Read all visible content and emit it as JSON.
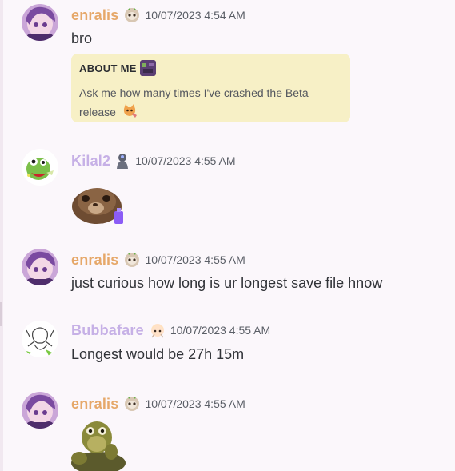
{
  "messages": [
    {
      "username": "enralis",
      "timestamp": "10/07/2023 4:54 AM",
      "text": "bro",
      "about_me": {
        "title": "ABOUT ME",
        "text": "Ask me how many times I've crashed the Beta",
        "text2": "release"
      }
    },
    {
      "username": "Kilal2",
      "timestamp": "10/07/2023 4:55 AM",
      "attachment": "hamster-sticker"
    },
    {
      "username": "enralis",
      "timestamp": "10/07/2023 4:55 AM",
      "text": "just curious how long is ur longest save file hnow"
    },
    {
      "username": "Bubbafare",
      "timestamp": "10/07/2023 4:55 AM",
      "text": "Longest would be 27h 15m"
    },
    {
      "username": "enralis",
      "timestamp": "10/07/2023 4:55 AM",
      "attachment": "turtle-sticker"
    }
  ],
  "colors": {
    "enralis": "#e6a86a",
    "kilal2": "#c6b0e6",
    "bubbafare": "#c6b0e6",
    "about_bg": "#f7f0c6"
  }
}
